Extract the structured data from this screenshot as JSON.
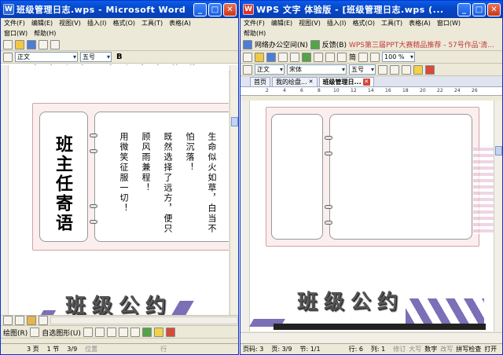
{
  "word": {
    "title": "班级管理日志.wps - Microsoft Word",
    "menus": [
      "文件(F)",
      "编辑(E)",
      "视图(V)",
      "插入(I)",
      "格式(O)",
      "工具(T)",
      "表格(A)"
    ],
    "menus_row2": [
      "窗口(W)",
      "帮助(H)"
    ],
    "style_combo": "正文",
    "size_combo": "五号",
    "bold_label": "B",
    "ruler_ticks": [
      "8",
      "6",
      "4",
      "2",
      "2",
      "4",
      "6",
      "8",
      "10",
      "12"
    ],
    "planner_title": "班主任寄语",
    "poem_columns": [
      "生命似火如草，白当不",
      "怕沉落！",
      "既然选择了远方，便只",
      "顾风雨兼程！",
      "用微笑征服一切！"
    ],
    "big_title": "班级公约",
    "draw_toolbar": {
      "draw": "绘图(R)",
      "autoshape": "自选图形(U)"
    },
    "status": {
      "page": "3 页",
      "section": "1 节",
      "pages": "3/9",
      "pos": "位置",
      "line": "行"
    }
  },
  "wps": {
    "title": "WPS 文字 体验版 - [班级管理日志.wps (...",
    "menus": [
      "文件(F)",
      "编辑(E)",
      "视图(V)",
      "插入(I)",
      "格式(O)",
      "工具(T)",
      "表格(A)",
      "窗口(W)"
    ],
    "menus_row2": [
      "帮助(H)"
    ],
    "net_label": "网络办公空间(N)",
    "feedback_label": "反馈(B)",
    "promo_text": "WPS第三届PPT大赛精品推荐 - 57号作品'清...",
    "zoom": "100 %",
    "simplified_label": "简",
    "style_combo": "正文",
    "font_combo": "宋体",
    "size_combo": "五号",
    "tabs": [
      "首页",
      "我的绘盘...",
      "班级管理日..."
    ],
    "ruler_ticks": [
      "2",
      "4",
      "6",
      "8",
      "10",
      "12",
      "14",
      "16",
      "18",
      "20",
      "22",
      "24",
      "26"
    ],
    "big_title": "班级公约",
    "status": [
      "页码: 3",
      "页: 3/9",
      "节: 1/1",
      "行: 6",
      "列: 1",
      "修订",
      "大写",
      "数字",
      "改写",
      "拼写检查",
      "打开"
    ]
  },
  "colors": {
    "title_blue": "#0547c8",
    "planner_pink": "#fbeeee",
    "accent_purple": "#7b6fb8",
    "accent_red": "#d6463a"
  }
}
